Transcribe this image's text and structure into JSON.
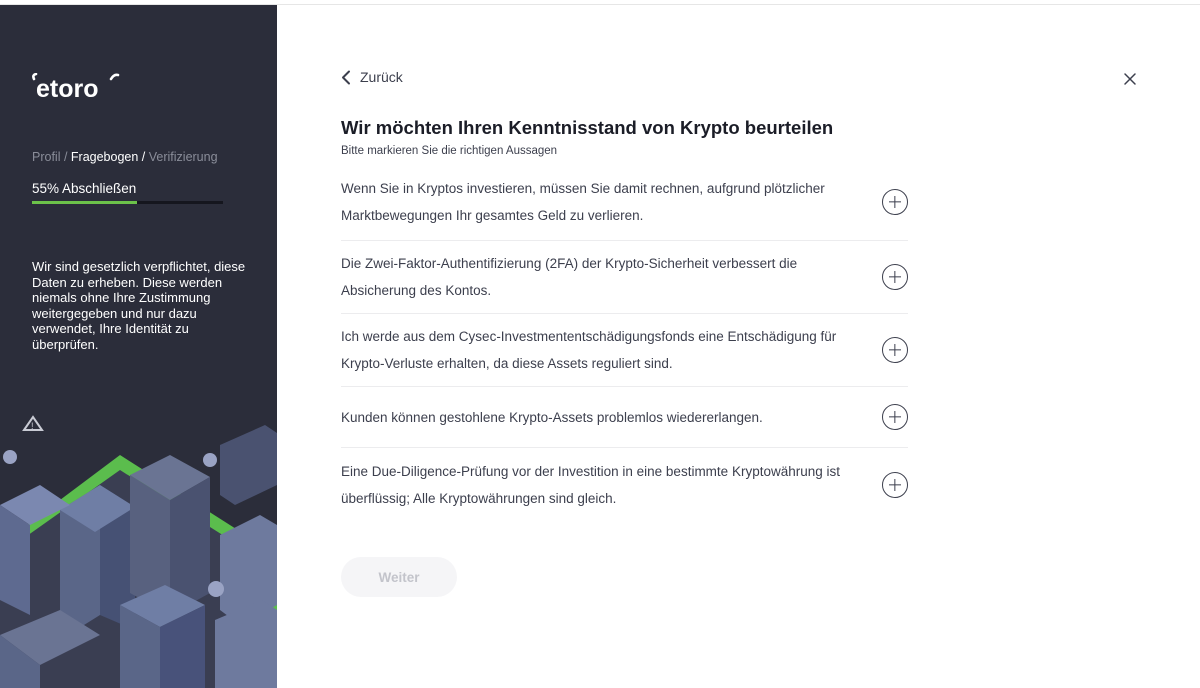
{
  "sidebar": {
    "logo_text": "etoro",
    "breadcrumb": {
      "step1": "Profil",
      "sep1": " / ",
      "step2": "Fragebogen",
      "sep2": " / ",
      "step3": "Verifizierung"
    },
    "progress_label": "55% Abschließen",
    "progress_value": 0.55,
    "legal_text": "Wir sind gesetzlich verpflichtet, diese Daten zu erheben. Diese werden niemals ohne Ihre Zustimmung weitergegeben und nur dazu verwendet, Ihre Identität zu überprüfen."
  },
  "main": {
    "back_label": "Zurück",
    "title": "Wir möchten Ihren Kenntnisstand von Krypto beurteilen",
    "subtitle": "Bitte markieren Sie die richtigen Aussagen",
    "statements": [
      "Wenn Sie in Kryptos investieren, müssen Sie damit rechnen, aufgrund plötzlicher Marktbewegungen Ihr gesamtes Geld zu verlieren.",
      "Die Zwei-Faktor-Authentifizierung (2FA) der Krypto-Sicherheit verbessert die Absicherung des Kontos.",
      "Ich werde aus dem Cysec-Investmententschädigungsfonds eine Entschädigung für Krypto-Verluste erhalten, da diese Assets reguliert sind.",
      "Kunden können gestohlene Krypto-Assets problemlos wiedererlangen.",
      "Eine Due-Diligence-Prüfung vor der Investition in eine bestimmte Kryptowährung ist überflüssig; Alle Kryptowährungen sind gleich."
    ],
    "next_label": "Weiter"
  },
  "colors": {
    "sidebar_bg": "#2b2d3a",
    "accent_green": "#6cc24a",
    "text_dark": "#1b1d27",
    "text_body": "#3c3f4d"
  },
  "icons": [
    "etoro-logo",
    "chevron-left-icon",
    "close-icon",
    "plus-circle-icon",
    "city-illustration"
  ]
}
